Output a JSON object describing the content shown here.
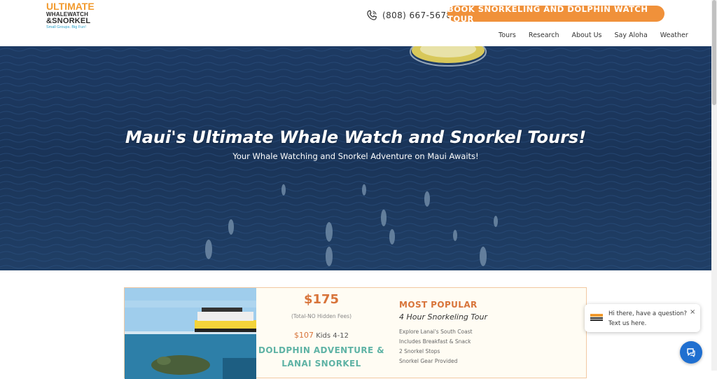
{
  "logo": {
    "line1": "ULTIMATE",
    "line2": "WHALEWATCH",
    "line3": "&SNORKEL",
    "tagline": "Small Groups. Big Fun!"
  },
  "header": {
    "phone": "(808) 667-5678",
    "phone_icon": "phone-icon",
    "cta_label": "BOOK SNORKELING AND DOLPHIN WATCH TOUR"
  },
  "nav": {
    "items": [
      {
        "label": "Tours"
      },
      {
        "label": "Research"
      },
      {
        "label": "About Us"
      },
      {
        "label": "Say Aloha"
      },
      {
        "label": "Weather"
      }
    ]
  },
  "hero": {
    "title": "Maui's Ultimate Whale Watch and Snorkel Tours!",
    "subtitle": "Your Whale Watching and Snorkel Adventure on Maui Awaits!"
  },
  "tour": {
    "price": "$175",
    "fees_note": "(Total-NO Hidden Fees)",
    "kids_price": "$107",
    "kids_label": "Kids 4-12",
    "name_line1": "DOLDPHIN ADVENTURE &",
    "name_line2": "LANAI SNORKEL",
    "badge": "MOST POPULAR",
    "duration": "4 Hour Snorkeling Tour",
    "features": [
      "Explore Lanai's South Coast",
      "Includes Breakfast & Snack",
      "2 Snorkel Stops",
      "Snorkel Gear Provided"
    ]
  },
  "chat": {
    "line1": "Hi there, have a question?",
    "line2": "Text us here.",
    "close": "×"
  },
  "colors": {
    "accent": "#f0913a",
    "teal": "#5fb3a5",
    "ocean": "#1c3b62",
    "chat_blue": "#1f6fd0"
  }
}
